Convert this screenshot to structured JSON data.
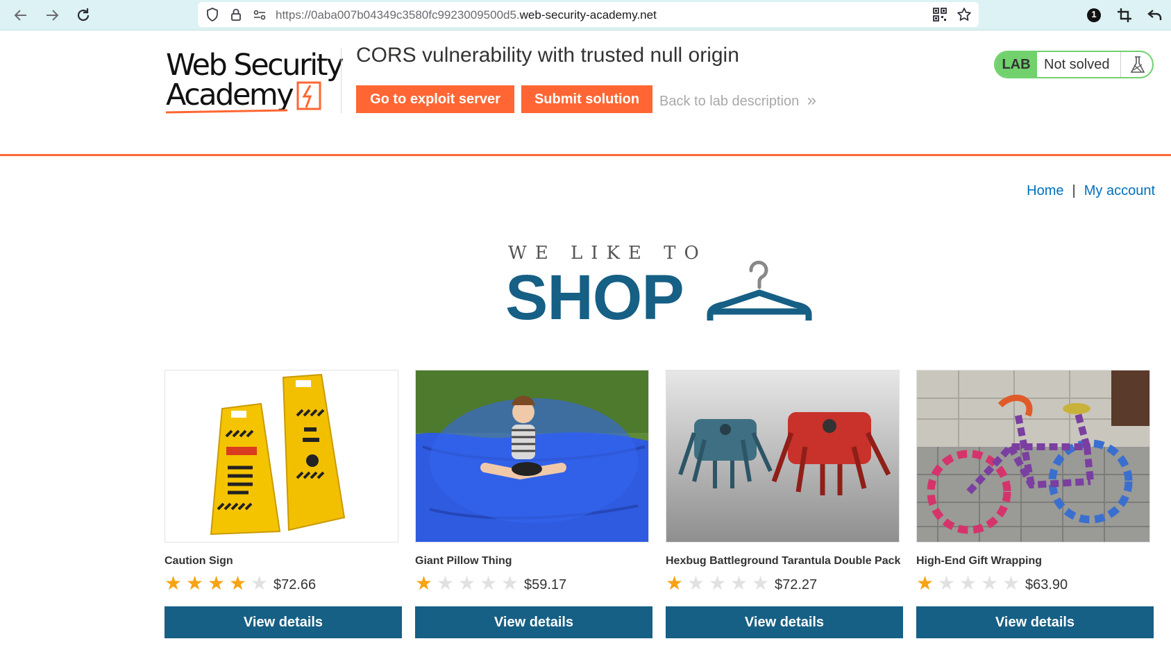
{
  "browser": {
    "url_prefix": "https://0aba007b04349c3580fc9923009500d5.",
    "url_host": "web-security-academy.net",
    "badge_count": "1"
  },
  "lab_header": {
    "logo_line1": "Web Security",
    "logo_line2": "Academy",
    "title": "CORS vulnerability with trusted null origin",
    "exploit_button": "Go to exploit server",
    "submit_button": "Submit solution",
    "back_link": "Back to lab description",
    "back_chevron": "»",
    "lab_tag": "LAB",
    "status": "Not solved"
  },
  "nav": {
    "home": "Home",
    "separator": "|",
    "account": "My account"
  },
  "banner": {
    "small": "WE LIKE TO",
    "big": "SHOP"
  },
  "colors": {
    "accent_orange": "#ff6633",
    "shop_blue": "#165f85",
    "lab_green": "#70d16d",
    "star_gold": "#f7a313",
    "link_blue": "#0071bc"
  },
  "products": [
    {
      "name": "Caution Sign",
      "rating": 4,
      "price": "$72.66",
      "button": "View details"
    },
    {
      "name": "Giant Pillow Thing",
      "rating": 1,
      "price": "$59.17",
      "button": "View details"
    },
    {
      "name": "Hexbug Battleground Tarantula Double Pack",
      "rating": 1,
      "price": "$72.27",
      "button": "View details"
    },
    {
      "name": "High-End Gift Wrapping",
      "rating": 1,
      "price": "$63.90",
      "button": "View details"
    }
  ]
}
